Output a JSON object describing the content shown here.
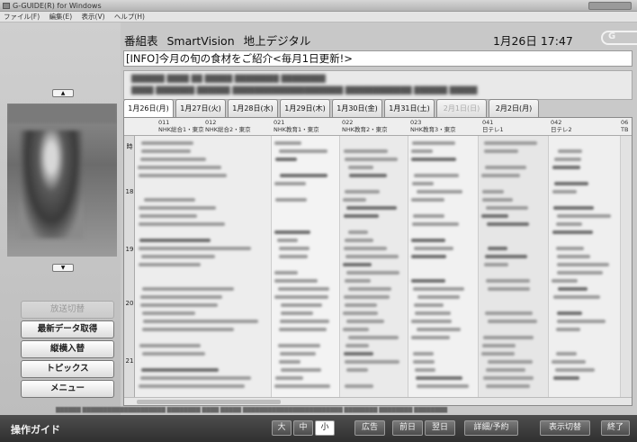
{
  "window": {
    "title": "G-GUIDE(R) for Windows"
  },
  "menu": [
    "ファイル(F)",
    "編集(E)",
    "表示(V)",
    "ヘルプ(H)"
  ],
  "header": {
    "section": "番組表",
    "service": "SmartVision",
    "band": "地上デジタル",
    "datetime": "1月26日 17:47"
  },
  "info": {
    "text": "[INFO]今月の旬の食材をご紹介<毎月1日更新!>"
  },
  "dates": [
    {
      "label": "1月26日(月)"
    },
    {
      "label": "1月27日(火)"
    },
    {
      "label": "1月28日(水)"
    },
    {
      "label": "1月29日(木)"
    },
    {
      "label": "1月30日(金)"
    },
    {
      "label": "1月31日(土)"
    },
    {
      "label": "2月1日(日)"
    },
    {
      "label": "2月2日(月)"
    }
  ],
  "channels": [
    {
      "num": "011",
      "name": "NHK総合1・東京"
    },
    {
      "num": "012",
      "name": "NHK総合2・東京"
    },
    {
      "num": "021",
      "name": "NHK教育1・東京"
    },
    {
      "num": "022",
      "name": "NHK教育2・東京"
    },
    {
      "num": "023",
      "name": "NHK教育3・東京"
    },
    {
      "num": "041",
      "name": "日テレ1"
    },
    {
      "num": "042",
      "name": "日テレ2"
    },
    {
      "num": "06",
      "name": "TB"
    }
  ],
  "hours": [
    "時",
    "18",
    "19",
    "20",
    "21"
  ],
  "side": {
    "up_arrow": "▲",
    "down_arrow": "▼",
    "buttons": [
      "放送切替",
      "最新データ取得",
      "縦横入替",
      "トピックス",
      "メニュー"
    ]
  },
  "bottom": {
    "guide": "操作ガイド",
    "size_buttons": [
      "大",
      "中",
      "小"
    ],
    "buttons": [
      "広告",
      "前日",
      "翌日",
      "詳細/予約",
      "表示切替",
      "終了"
    ]
  }
}
